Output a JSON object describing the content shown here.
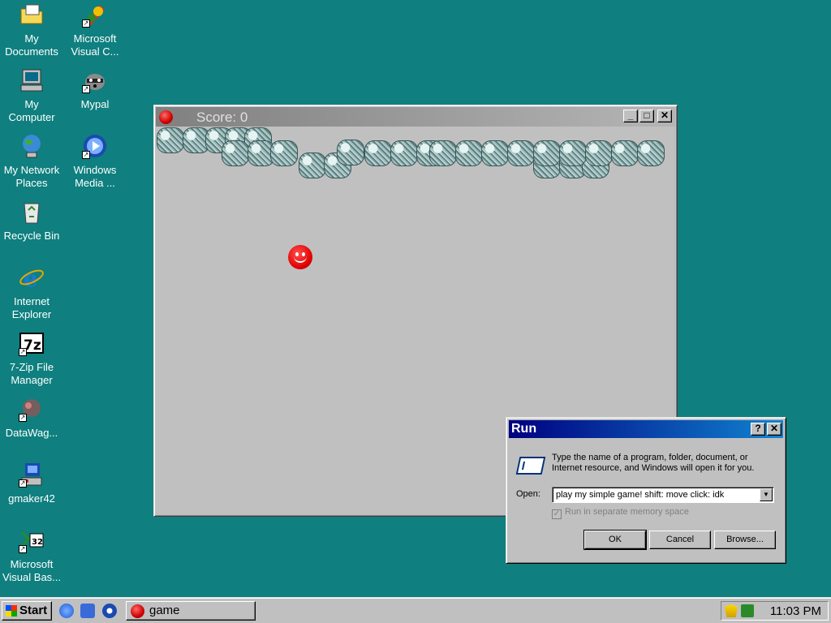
{
  "desktop": {
    "icons": [
      {
        "label": "My Documents"
      },
      {
        "label": "Microsoft Visual C..."
      },
      {
        "label": "My Computer"
      },
      {
        "label": "Mypal"
      },
      {
        "label": "My Network Places"
      },
      {
        "label": "Windows Media ..."
      },
      {
        "label": "Recycle Bin"
      },
      {
        "label": "Internet Explorer"
      },
      {
        "label": "7-Zip File Manager"
      },
      {
        "label": "DataWag..."
      },
      {
        "label": "gmaker42"
      },
      {
        "label": "Microsoft Visual Bas..."
      }
    ]
  },
  "game_window": {
    "title": "Score: 0",
    "minimize": "_",
    "maximize": "□",
    "close": "✕"
  },
  "run_dialog": {
    "title": "Run",
    "help": "?",
    "close": "✕",
    "description": "Type the name of a program, folder, document, or Internet resource, and Windows will open it for you.",
    "open_label": "Open:",
    "open_value": "play my simple game! shift: move click: idk",
    "dropdown_arrow": "▼",
    "checkbox_label": "Run in separate memory space",
    "checkbox_checked": true,
    "checkbox_mark": "✓",
    "ok": "OK",
    "cancel": "Cancel",
    "browse": "Browse..."
  },
  "taskbar": {
    "start": "Start",
    "task_button": "game",
    "clock": "11:03 PM"
  }
}
